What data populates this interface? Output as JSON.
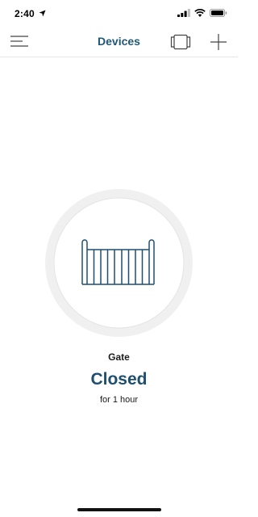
{
  "status_bar": {
    "time": "2:40",
    "icons": [
      "location-arrow-icon",
      "signal-icon",
      "wifi-icon",
      "battery-icon"
    ]
  },
  "nav": {
    "title": "Devices",
    "left_icon": "menu-icon",
    "right_icons": [
      "card-view-icon",
      "add-icon"
    ]
  },
  "device": {
    "icon": "gate-icon",
    "name": "Gate",
    "state": "Closed",
    "duration": "for 1 hour"
  },
  "colors": {
    "accent": "#1f5777",
    "state_text": "#1f4f70",
    "gate_stroke": "#1f4f70"
  }
}
